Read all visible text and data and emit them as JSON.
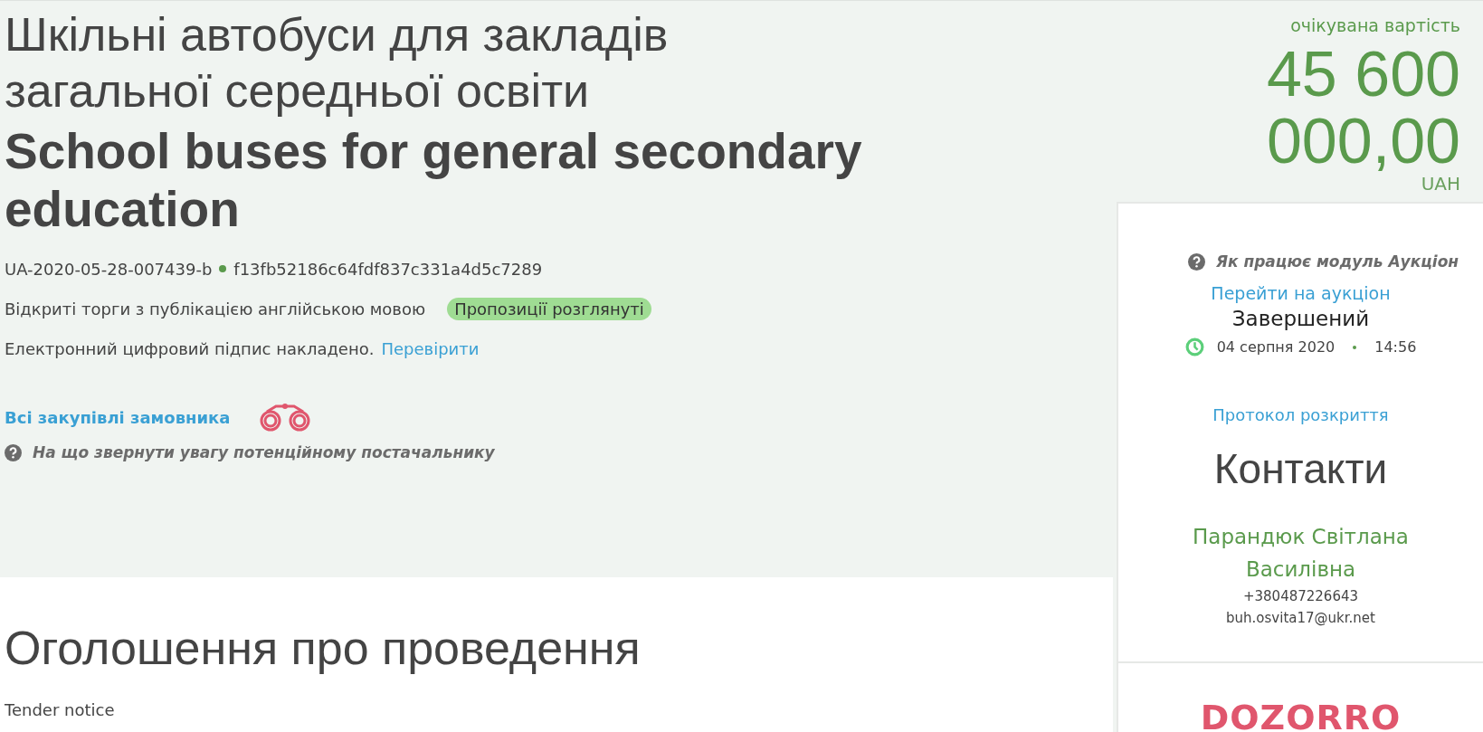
{
  "tender": {
    "title_uk": [
      "Шкільні автобуси для закладів",
      "загальної середньої освіти"
    ],
    "title_en": "School buses for general secondary education",
    "id": "UA-2020-05-28-007439-b",
    "hash": "f13fb52186c64fdf837c331a4d5c7289",
    "procedure": "Відкриті торги з публікацією англійською мовою",
    "status_badge": "Пропозиції розглянуті",
    "signature_text": "Електронний цифровий підпис накладено.",
    "signature_link": "Перевірити",
    "customer_link": "Всі закупівлі замовника",
    "hint": "На що звернути увагу потенційному постачальнику"
  },
  "price": {
    "label": "очікувана вартість",
    "amount": "45 600 000,00",
    "currency": "UAH"
  },
  "auction": {
    "help": "Як працює модуль Аукціон",
    "link": "Перейти на аукціон",
    "status": "Завершений",
    "date": "04 серпня 2020",
    "time": "14:56",
    "protocol": "Протокол розкриття"
  },
  "contacts": {
    "heading": "Контакти",
    "name": "Парандюк Світлана Василівна",
    "phone": "+380487226643",
    "email": "buh.osvita17@ukr.net"
  },
  "logo": "DOZORRO",
  "notice": {
    "heading": "Оголошення про проведення",
    "subheading": "Tender notice"
  }
}
